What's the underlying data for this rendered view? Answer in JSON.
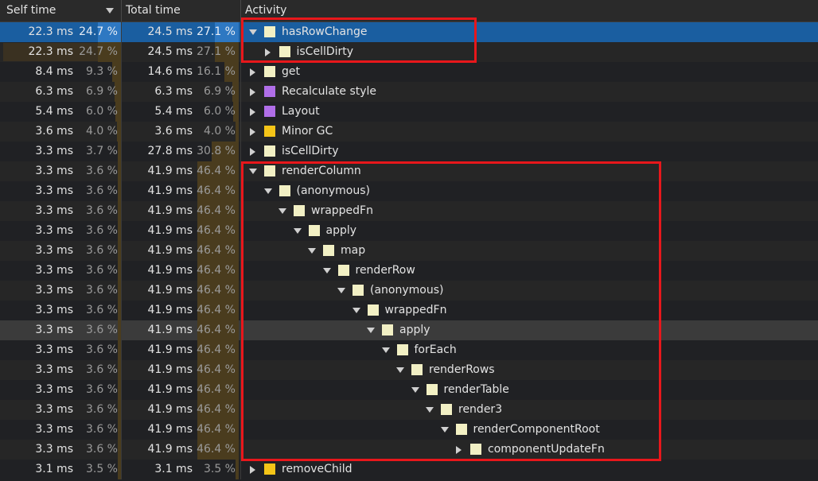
{
  "header": {
    "self_time": "Self time",
    "total_time": "Total time",
    "activity": "Activity",
    "sort_icon": "chevron-down-icon"
  },
  "colors": {
    "script": "#f2f0c4",
    "rendering": "#b06ee8",
    "gc": "#f5c518",
    "selection": "#1a5ea0",
    "highlight_box": "#e8171b"
  },
  "rows": [
    {
      "self_ms": "22.3 ms",
      "self_pct": "24.7 %",
      "total_ms": "24.5 ms",
      "total_pct": "27.1 %",
      "name": "hasRowChange",
      "depth": 0,
      "expanded": true,
      "expandable": true,
      "category": "script",
      "state": "selected",
      "self_frac": 0.247,
      "total_frac": 0.271
    },
    {
      "self_ms": "22.3 ms",
      "self_pct": "24.7 %",
      "total_ms": "24.5 ms",
      "total_pct": "27.1 %",
      "name": "isCellDirty",
      "depth": 1,
      "expanded": false,
      "expandable": true,
      "category": "script",
      "state": "",
      "self_frac": 0.247,
      "total_frac": 0.271,
      "self_full": true
    },
    {
      "self_ms": "8.4 ms",
      "self_pct": "9.3 %",
      "total_ms": "14.6 ms",
      "total_pct": "16.1 %",
      "name": "get",
      "depth": 0,
      "expanded": false,
      "expandable": true,
      "category": "script",
      "state": "",
      "self_frac": 0.093,
      "total_frac": 0.161
    },
    {
      "self_ms": "6.3 ms",
      "self_pct": "6.9 %",
      "total_ms": "6.3 ms",
      "total_pct": "6.9 %",
      "name": "Recalculate style",
      "depth": 0,
      "expanded": false,
      "expandable": true,
      "category": "rendering",
      "state": "",
      "self_frac": 0.069,
      "total_frac": 0.069
    },
    {
      "self_ms": "5.4 ms",
      "self_pct": "6.0 %",
      "total_ms": "5.4 ms",
      "total_pct": "6.0 %",
      "name": "Layout",
      "depth": 0,
      "expanded": false,
      "expandable": true,
      "category": "rendering",
      "state": "",
      "self_frac": 0.06,
      "total_frac": 0.06
    },
    {
      "self_ms": "3.6 ms",
      "self_pct": "4.0 %",
      "total_ms": "3.6 ms",
      "total_pct": "4.0 %",
      "name": "Minor GC",
      "depth": 0,
      "expanded": false,
      "expandable": true,
      "category": "gc",
      "state": "",
      "self_frac": 0.04,
      "total_frac": 0.04
    },
    {
      "self_ms": "3.3 ms",
      "self_pct": "3.7 %",
      "total_ms": "27.8 ms",
      "total_pct": "30.8 %",
      "name": "isCellDirty",
      "depth": 0,
      "expanded": false,
      "expandable": true,
      "category": "script",
      "state": "",
      "self_frac": 0.037,
      "total_frac": 0.308
    },
    {
      "self_ms": "3.3 ms",
      "self_pct": "3.6 %",
      "total_ms": "41.9 ms",
      "total_pct": "46.4 %",
      "name": "renderColumn",
      "depth": 0,
      "expanded": true,
      "expandable": true,
      "category": "script",
      "state": "",
      "self_frac": 0.036,
      "total_frac": 0.464
    },
    {
      "self_ms": "3.3 ms",
      "self_pct": "3.6 %",
      "total_ms": "41.9 ms",
      "total_pct": "46.4 %",
      "name": "(anonymous)",
      "depth": 1,
      "expanded": true,
      "expandable": true,
      "category": "script",
      "state": "",
      "self_frac": 0.036,
      "total_frac": 0.464
    },
    {
      "self_ms": "3.3 ms",
      "self_pct": "3.6 %",
      "total_ms": "41.9 ms",
      "total_pct": "46.4 %",
      "name": "wrappedFn",
      "depth": 2,
      "expanded": true,
      "expandable": true,
      "category": "script",
      "state": "",
      "self_frac": 0.036,
      "total_frac": 0.464
    },
    {
      "self_ms": "3.3 ms",
      "self_pct": "3.6 %",
      "total_ms": "41.9 ms",
      "total_pct": "46.4 %",
      "name": "apply",
      "depth": 3,
      "expanded": true,
      "expandable": true,
      "category": "script",
      "state": "",
      "self_frac": 0.036,
      "total_frac": 0.464
    },
    {
      "self_ms": "3.3 ms",
      "self_pct": "3.6 %",
      "total_ms": "41.9 ms",
      "total_pct": "46.4 %",
      "name": "map",
      "depth": 4,
      "expanded": true,
      "expandable": true,
      "category": "script",
      "state": "",
      "self_frac": 0.036,
      "total_frac": 0.464
    },
    {
      "self_ms": "3.3 ms",
      "self_pct": "3.6 %",
      "total_ms": "41.9 ms",
      "total_pct": "46.4 %",
      "name": "renderRow",
      "depth": 5,
      "expanded": true,
      "expandable": true,
      "category": "script",
      "state": "",
      "self_frac": 0.036,
      "total_frac": 0.464
    },
    {
      "self_ms": "3.3 ms",
      "self_pct": "3.6 %",
      "total_ms": "41.9 ms",
      "total_pct": "46.4 %",
      "name": "(anonymous)",
      "depth": 6,
      "expanded": true,
      "expandable": true,
      "category": "script",
      "state": "",
      "self_frac": 0.036,
      "total_frac": 0.464
    },
    {
      "self_ms": "3.3 ms",
      "self_pct": "3.6 %",
      "total_ms": "41.9 ms",
      "total_pct": "46.4 %",
      "name": "wrappedFn",
      "depth": 7,
      "expanded": true,
      "expandable": true,
      "category": "script",
      "state": "",
      "self_frac": 0.036,
      "total_frac": 0.464
    },
    {
      "self_ms": "3.3 ms",
      "self_pct": "3.6 %",
      "total_ms": "41.9 ms",
      "total_pct": "46.4 %",
      "name": "apply",
      "depth": 8,
      "expanded": true,
      "expandable": true,
      "category": "script",
      "state": "hover",
      "self_frac": 0.036,
      "total_frac": 0.464
    },
    {
      "self_ms": "3.3 ms",
      "self_pct": "3.6 %",
      "total_ms": "41.9 ms",
      "total_pct": "46.4 %",
      "name": "forEach",
      "depth": 9,
      "expanded": true,
      "expandable": true,
      "category": "script",
      "state": "",
      "self_frac": 0.036,
      "total_frac": 0.464
    },
    {
      "self_ms": "3.3 ms",
      "self_pct": "3.6 %",
      "total_ms": "41.9 ms",
      "total_pct": "46.4 %",
      "name": "renderRows",
      "depth": 10,
      "expanded": true,
      "expandable": true,
      "category": "script",
      "state": "",
      "self_frac": 0.036,
      "total_frac": 0.464
    },
    {
      "self_ms": "3.3 ms",
      "self_pct": "3.6 %",
      "total_ms": "41.9 ms",
      "total_pct": "46.4 %",
      "name": "renderTable",
      "depth": 11,
      "expanded": true,
      "expandable": true,
      "category": "script",
      "state": "",
      "self_frac": 0.036,
      "total_frac": 0.464
    },
    {
      "self_ms": "3.3 ms",
      "self_pct": "3.6 %",
      "total_ms": "41.9 ms",
      "total_pct": "46.4 %",
      "name": "render3",
      "depth": 12,
      "expanded": true,
      "expandable": true,
      "category": "script",
      "state": "",
      "self_frac": 0.036,
      "total_frac": 0.464
    },
    {
      "self_ms": "3.3 ms",
      "self_pct": "3.6 %",
      "total_ms": "41.9 ms",
      "total_pct": "46.4 %",
      "name": "renderComponentRoot",
      "depth": 13,
      "expanded": true,
      "expandable": true,
      "category": "script",
      "state": "",
      "self_frac": 0.036,
      "total_frac": 0.464
    },
    {
      "self_ms": "3.3 ms",
      "self_pct": "3.6 %",
      "total_ms": "41.9 ms",
      "total_pct": "46.4 %",
      "name": "componentUpdateFn",
      "depth": 14,
      "expanded": false,
      "expandable": true,
      "category": "script",
      "state": "",
      "self_frac": 0.036,
      "total_frac": 0.464
    },
    {
      "self_ms": "3.1 ms",
      "self_pct": "3.5 %",
      "total_ms": "3.1 ms",
      "total_pct": "3.5 %",
      "name": "removeChild",
      "depth": 0,
      "expanded": false,
      "expandable": true,
      "category": "gc",
      "state": "",
      "self_frac": 0.035,
      "total_frac": 0.035
    }
  ]
}
